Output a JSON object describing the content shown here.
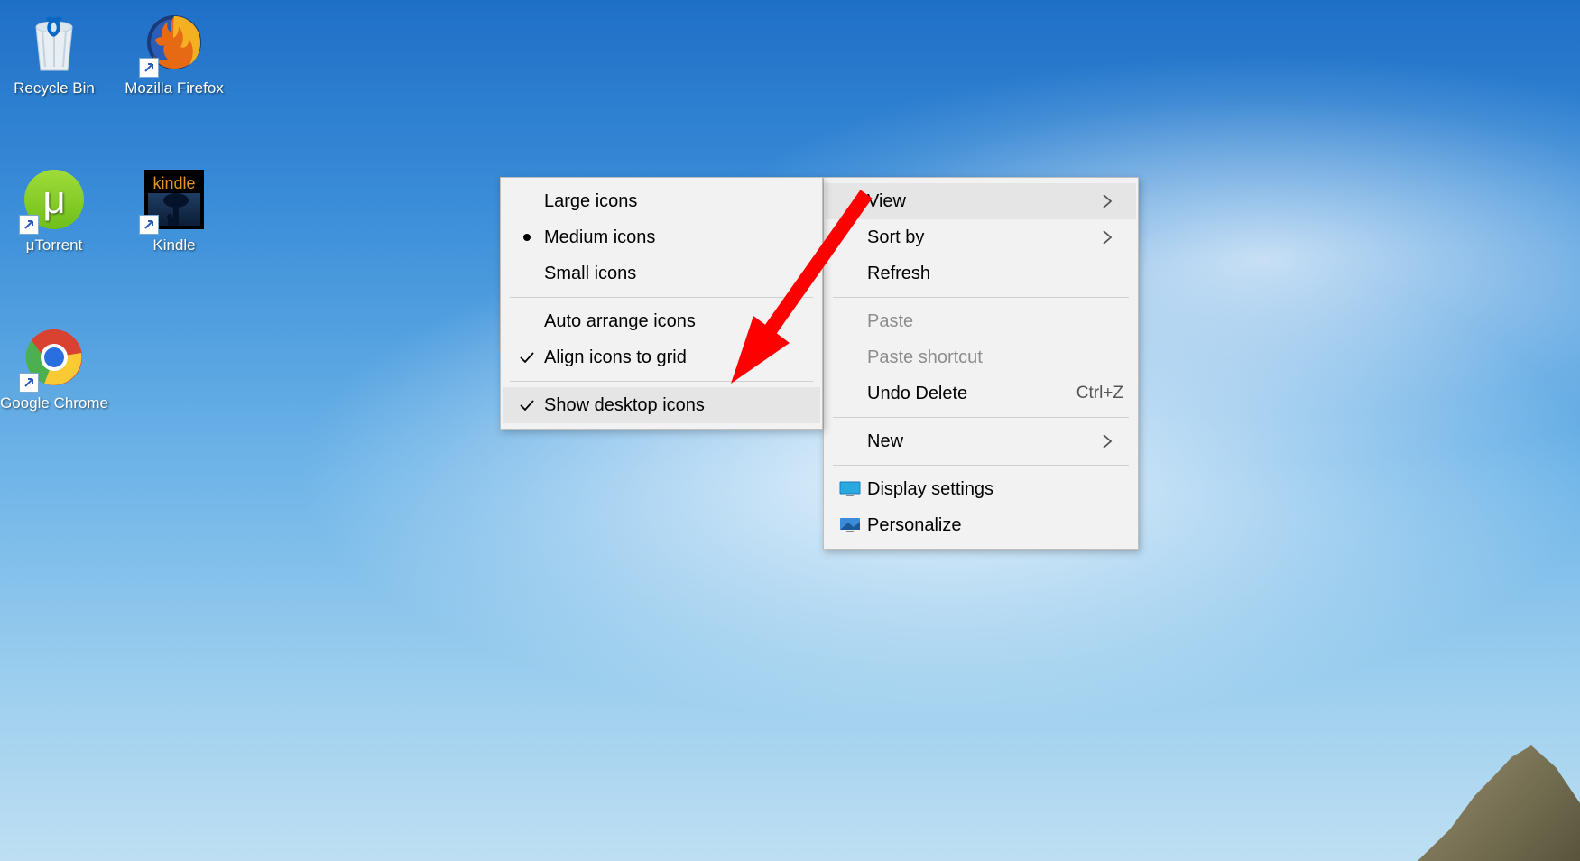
{
  "desktop_icons": {
    "recycle_bin": "Recycle Bin",
    "firefox": "Mozilla Firefox",
    "utorrent": "μTorrent",
    "kindle": "Kindle",
    "kindle_brand": "kindle",
    "chrome": "Google Chrome",
    "utorrent_glyph": "μ"
  },
  "context_menu": {
    "view": "View",
    "sort_by": "Sort by",
    "refresh": "Refresh",
    "paste": "Paste",
    "paste_shortcut": "Paste shortcut",
    "undo_delete": "Undo Delete",
    "undo_delete_shortcut": "Ctrl+Z",
    "new": "New",
    "display_settings": "Display settings",
    "personalize": "Personalize"
  },
  "view_submenu": {
    "large_icons": "Large icons",
    "medium_icons": "Medium icons",
    "small_icons": "Small icons",
    "auto_arrange": "Auto arrange icons",
    "align_grid": "Align icons to grid",
    "show_desktop": "Show desktop icons"
  }
}
